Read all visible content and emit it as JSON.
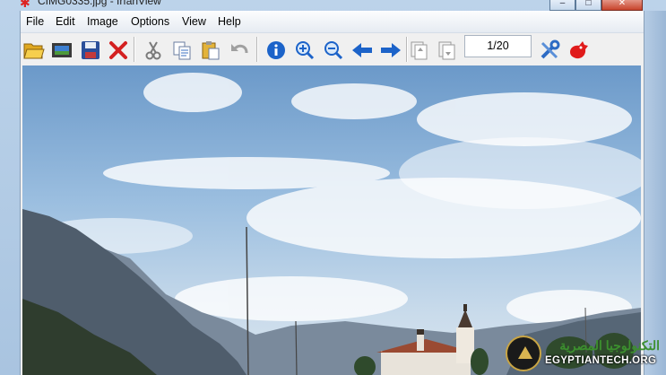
{
  "window": {
    "title": "CIMG0335.jpg - IrfanView",
    "minimize": "–",
    "maximize": "□",
    "close": "✕"
  },
  "menu": [
    "File",
    "Edit",
    "Image",
    "Options",
    "View",
    "Help"
  ],
  "toolbar": {
    "icons": [
      "open-folder-icon",
      "slideshow-icon",
      "save-icon",
      "delete-icon",
      "cut-icon",
      "copy-icon",
      "paste-icon",
      "undo-icon",
      "info-icon",
      "zoom-in-icon",
      "zoom-out-icon",
      "previous-arrow-icon",
      "next-arrow-icon",
      "first-page-icon",
      "last-page-icon",
      "settings-icon",
      "irfanview-logo-icon"
    ],
    "page_counter": "1/20"
  },
  "colors": {
    "accent_blue": "#1c63c9",
    "delete_red": "#d42020",
    "sky_top": "#6f9ccb",
    "mountain": "#5a6a7a"
  },
  "watermark": {
    "arabic": "التكنولوجيا المصرية",
    "english": "EGYPTIANTECH.ORG"
  }
}
